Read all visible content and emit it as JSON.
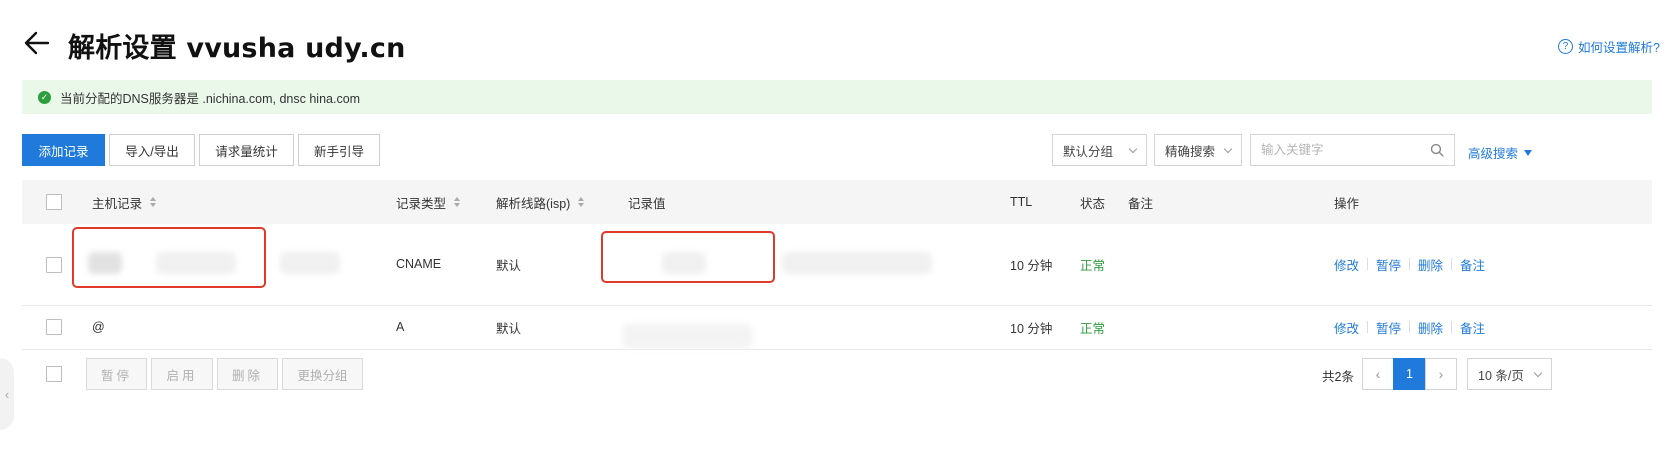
{
  "header": {
    "title": "解析设置 vvusha   udy.cn",
    "help_link": "如何设置解析?"
  },
  "notice": {
    "text": "当前分配的DNS服务器是     .nichina.com, dnsc     hina.com"
  },
  "toolbar": {
    "add_record": "添加记录",
    "import_export": "导入/导出",
    "request_stats": "请求量统计",
    "beginner_guide": "新手引导",
    "group_select": "默认分组",
    "search_mode": "精确搜索",
    "search_placeholder": "输入关键字",
    "advanced_search": "高级搜索"
  },
  "table": {
    "columns": {
      "host": "主机记录",
      "type": "记录类型",
      "line": "解析线路(isp)",
      "value": "记录值",
      "ttl": "TTL",
      "status": "状态",
      "remark": "备注",
      "actions": "操作"
    },
    "rows": [
      {
        "host": "",
        "type": "CNAME",
        "line": "默认",
        "value": "",
        "ttl": "10 分钟",
        "status": "正常",
        "remark": "",
        "actions": {
          "edit": "修改",
          "pause": "暂停",
          "delete": "删除",
          "note": "备注"
        }
      },
      {
        "host": "@",
        "type": "A",
        "line": "默认",
        "value": "",
        "ttl": "10 分钟",
        "status": "正常",
        "remark": "",
        "actions": {
          "edit": "修改",
          "pause": "暂停",
          "delete": "删除",
          "note": "备注"
        }
      }
    ]
  },
  "footer": {
    "pause": "暂停",
    "enable": "启用",
    "delete": "删除",
    "change_group": "更换分组",
    "total": "共2条",
    "current_page": "1",
    "page_size": "10 条/页"
  },
  "colors": {
    "primary": "#1f7adb",
    "success": "#2e9d3e",
    "notice_bg": "#eaf8ea",
    "highlight": "#e03a2b"
  },
  "icons": [
    "back-arrow-icon",
    "help-circle-icon",
    "check-circle-icon",
    "search-icon",
    "chevron-down-icon",
    "triangle-down-icon",
    "sort-icon",
    "chevron-left-icon",
    "chevron-right-icon"
  ]
}
